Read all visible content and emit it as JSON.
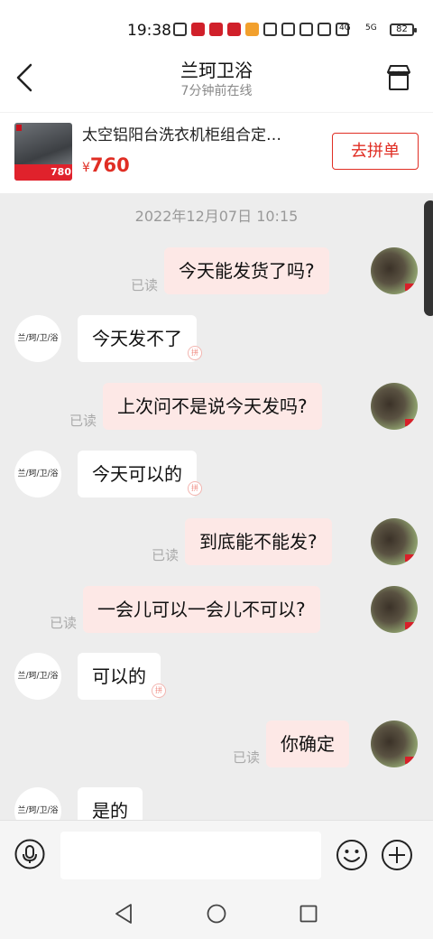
{
  "status_bar": {
    "time": "19:38",
    "battery": "82",
    "signal_1": "4G",
    "signal_2": "5G"
  },
  "header": {
    "title": "兰珂卫浴",
    "subtitle": "7分钟前在线"
  },
  "product": {
    "name": "太空铝阳台洗衣机柜组合定…",
    "currency": "¥",
    "price": "760",
    "thumb_badge": "780",
    "group_buy_label": "去拼单"
  },
  "chat": {
    "timestamp": "2022年12月07日 10:15",
    "shop_avatar_text": "兰/珂/卫/浴",
    "read_label": "已读",
    "seal_glyph": "拼",
    "messages": [
      {
        "from": "me",
        "text": "今天能发货了吗?",
        "read": true
      },
      {
        "from": "shop",
        "text": "今天发不了"
      },
      {
        "from": "me",
        "text": "上次问不是说今天发吗?",
        "read": true
      },
      {
        "from": "shop",
        "text": "今天可以的"
      },
      {
        "from": "me",
        "text": "到底能不能发?",
        "read": true
      },
      {
        "from": "me",
        "text": "一会儿可以一会儿不可以?",
        "read": true
      },
      {
        "from": "shop",
        "text": "可以的"
      },
      {
        "from": "me",
        "text": "你确定",
        "read": true
      },
      {
        "from": "shop",
        "text": "是的"
      }
    ]
  },
  "input": {
    "value": "",
    "placeholder": ""
  },
  "icons": {
    "back": "chevron-left-icon",
    "shop": "store-icon",
    "mic": "microphone-icon",
    "emoji": "smile-icon",
    "plus": "plus-circle-icon"
  }
}
